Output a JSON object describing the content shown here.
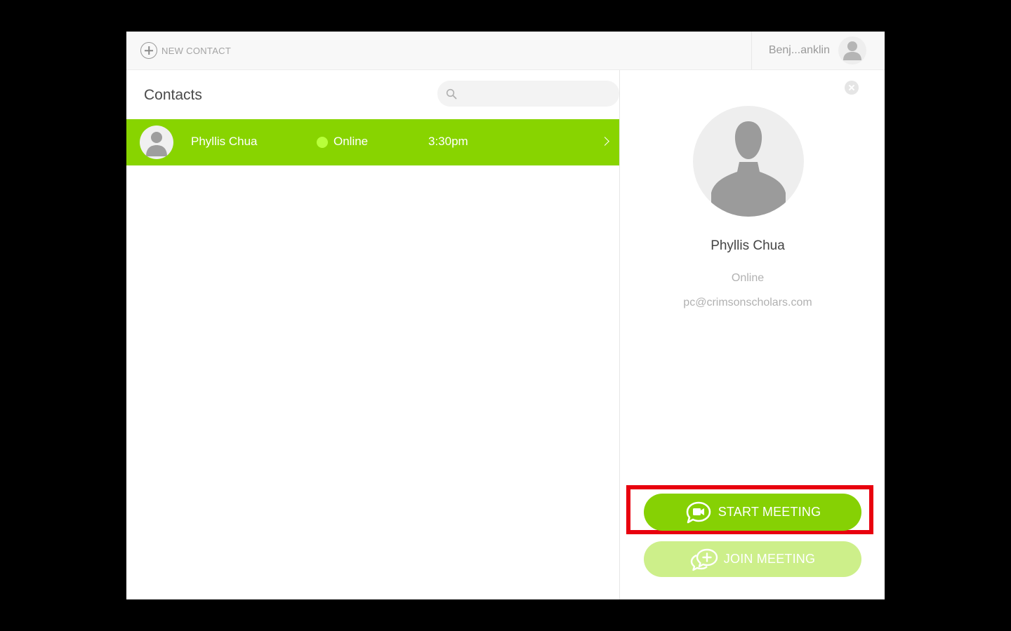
{
  "topbar": {
    "new_contact_label": "NEW CONTACT",
    "user_name": "Benj...anklin"
  },
  "contacts": {
    "title": "Contacts",
    "search_value": "",
    "rows": [
      {
        "name": "Phyllis Chua",
        "status": "Online",
        "time": "3:30pm"
      }
    ]
  },
  "detail": {
    "name": "Phyllis Chua",
    "status": "Online",
    "email": "pc@crimsonscholars.com",
    "start_meeting_label": "START MEETING",
    "join_meeting_label": "JOIN MEETING"
  },
  "colors": {
    "accent_green": "#86d104",
    "online_dot": "#b8ff3a",
    "join_button_light": "#cdef8a",
    "highlight_red": "#e8000e"
  },
  "icons": {
    "new_contact": "plus-circle-icon",
    "search": "search-icon",
    "close": "close-icon",
    "start_meeting": "video-chat-icon",
    "join_meeting": "chat-plus-icon",
    "row_chevron": "chevron-right-icon"
  }
}
